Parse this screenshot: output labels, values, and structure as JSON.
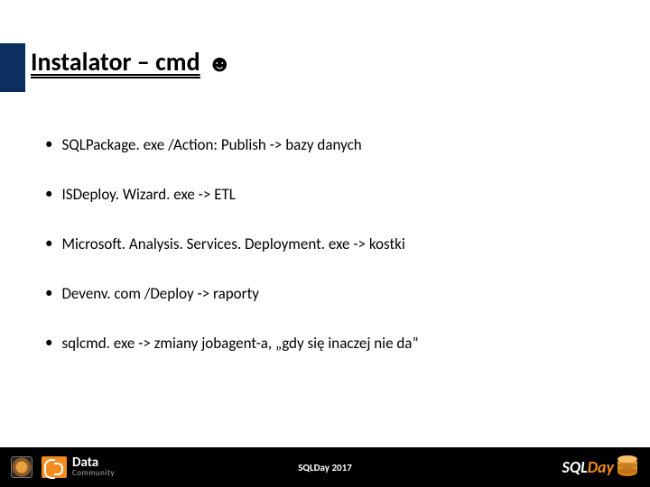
{
  "header": {
    "title": "Instalator – cmd",
    "icon": "☻"
  },
  "bullets": [
    "SQLPackage. exe /Action: Publish -> bazy danych",
    "ISDeploy. Wizard. exe -> ETL",
    "Microsoft. Analysis. Services. Deployment. exe -> kostki",
    "Devenv. com /Deploy -> raporty",
    "sqlcmd. exe -> zmiany jobagent-a, „gdy się inaczej nie da”"
  ],
  "footer": {
    "community_big": "Data",
    "community_small": "Community",
    "center": "SQLDay 2017",
    "brand_sql": "SQL",
    "brand_day": "Day"
  }
}
